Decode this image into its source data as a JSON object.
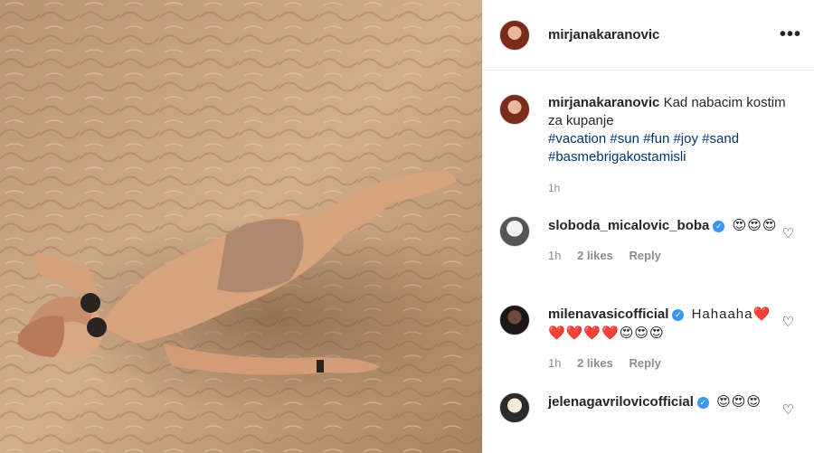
{
  "post": {
    "username": "mirjanakaranovic",
    "more_icon": "more-horizontal-icon"
  },
  "caption": {
    "username": "mirjanakaranovic",
    "text": "Kad nabacim kostim za kupanje",
    "hashtags": [
      "#vacation",
      "#sun",
      "#fun",
      "#joy",
      "#sand",
      "#basmebrigakostamisli"
    ],
    "time": "1h"
  },
  "comments": [
    {
      "username": "sloboda_micalovic_boba",
      "verified": true,
      "text": "😍😍😍",
      "time": "1h",
      "likes": "2 likes",
      "reply": "Reply"
    },
    {
      "username": "milenavasicofficial",
      "verified": true,
      "text": "Hahaaha❤️❤️❤️❤️❤️😍😍😍",
      "time": "1h",
      "likes": "2 likes",
      "reply": "Reply"
    },
    {
      "username": "jelenagavrilovicofficial",
      "verified": true,
      "text": "😍😍😍"
    }
  ],
  "colors": {
    "hashtag": "#00376b",
    "verified": "#3897f0",
    "muted": "#8e8e8e",
    "sand": "#c9a683"
  }
}
